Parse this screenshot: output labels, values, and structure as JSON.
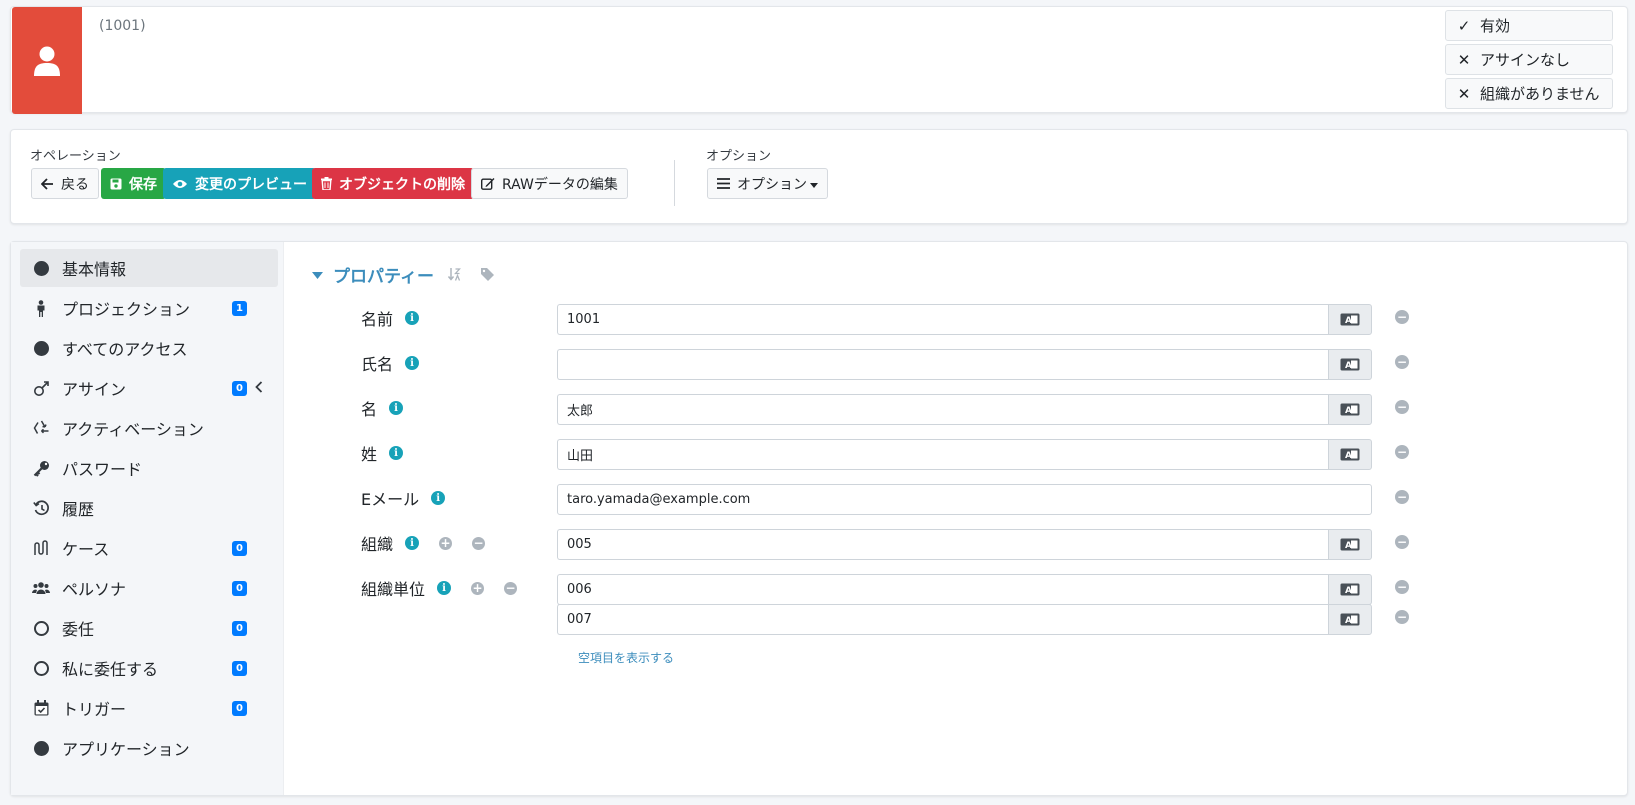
{
  "header": {
    "object_id": "(1001)",
    "avatar_icon": "user-icon",
    "avatar_color": "#e34c3b",
    "status_tags": [
      {
        "icon": "check-icon",
        "label": "有効"
      },
      {
        "icon": "x-icon",
        "label": "アサインなし"
      },
      {
        "icon": "x-icon",
        "label": "組織がありません"
      }
    ]
  },
  "operations": {
    "label": "オペレーション",
    "back": "戻る",
    "save": "保存",
    "preview": "変更のプレビュー",
    "delete": "オブジェクトの削除",
    "edit_raw": "RAWデータの編集"
  },
  "options": {
    "label": "オプション",
    "button": "オプション"
  },
  "sidebar": {
    "items": [
      {
        "label": "基本情報",
        "icon": "circle-icon"
      },
      {
        "label": "プロジェクション",
        "icon": "person-icon",
        "badge": "1"
      },
      {
        "label": "すべてのアクセス",
        "icon": "circle-icon"
      },
      {
        "label": "アサイン",
        "icon": "gender-icon",
        "badge": "0"
      },
      {
        "label": "アクティベーション",
        "icon": "recycle-icon"
      },
      {
        "label": "パスワード",
        "icon": "key-icon"
      },
      {
        "label": "履歴",
        "icon": "history-icon"
      },
      {
        "label": "ケース",
        "icon": "case-icon",
        "badge": "0"
      },
      {
        "label": "ペルソナ",
        "icon": "users-icon",
        "badge": "0"
      },
      {
        "label": "委任",
        "icon": "circle-outline-icon",
        "badge": "0"
      },
      {
        "label": "私に委任する",
        "icon": "circle-outline-icon",
        "badge": "0"
      },
      {
        "label": "トリガー",
        "icon": "calendar-check-icon",
        "badge": "0"
      },
      {
        "label": "アプリケーション",
        "icon": "circle-icon"
      }
    ]
  },
  "properties": {
    "title": "プロパティー",
    "fields": [
      {
        "label": "名前",
        "value": "1001"
      },
      {
        "label": "氏名",
        "value": ""
      },
      {
        "label": "名",
        "value": "太郎"
      },
      {
        "label": "姓",
        "value": "山田"
      },
      {
        "label": "Eメール",
        "value": "taro.yamada@example.com"
      },
      {
        "label": "組織",
        "value": "005"
      },
      {
        "label": "組織単位",
        "values": [
          "006",
          "007"
        ]
      }
    ],
    "show_empty": "空項目を表示する"
  }
}
